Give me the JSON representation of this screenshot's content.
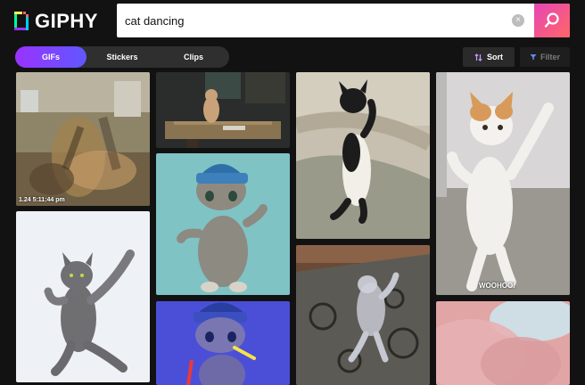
{
  "header": {
    "logo_text": "GIPHY",
    "search_value": "cat dancing",
    "clear_icon": "x-circle-icon",
    "search_icon": "magnifier-icon"
  },
  "tabs": [
    {
      "label": "GIFs",
      "active": true
    },
    {
      "label": "Stickers",
      "active": false
    },
    {
      "label": "Clips",
      "active": false
    }
  ],
  "controls": {
    "sort_label": "Sort",
    "filter_label": "Filter"
  },
  "gifs": [
    {
      "id": "crowd-cat",
      "caption": "1.24 5:11:44 pm"
    },
    {
      "id": "kitchen-cat",
      "caption": ""
    },
    {
      "id": "standing-tuxedo-cat",
      "caption": ""
    },
    {
      "id": "orange-white-kitten",
      "caption": "WOOHOO!"
    },
    {
      "id": "gray-cat-jumping",
      "caption": ""
    },
    {
      "id": "beanie-kitten",
      "caption": ""
    },
    {
      "id": "rug-dancing-cat",
      "caption": ""
    },
    {
      "id": "beanie-kitten-blue",
      "caption": ""
    },
    {
      "id": "pink-fur",
      "caption": ""
    }
  ],
  "colors": {
    "background": "#121212",
    "accent_gradient_start": "#9933ff",
    "accent_gradient_end": "#6157ff",
    "search_button_start": "#e646b6",
    "search_button_end": "#ff6666"
  }
}
